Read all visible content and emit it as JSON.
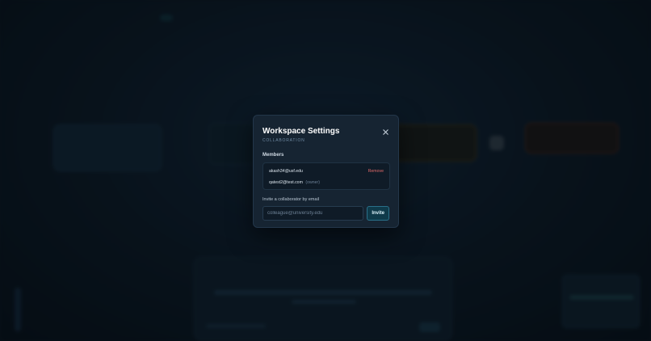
{
  "modal": {
    "title": "Workspace Settings",
    "subtitle": "COLLABORATION",
    "close_icon": "close-icon",
    "members_heading": "Members",
    "members": [
      {
        "email": "akash34@usf.edu",
        "owner_tag": "",
        "action": "Remove"
      },
      {
        "email": "qatest2@test.com",
        "owner_tag": "(owner)",
        "action": ""
      }
    ],
    "invite_label": "Invite a collaborator by email",
    "invite_placeholder": "colleague@university.edu",
    "invite_value": "",
    "invite_button": "Invite"
  },
  "colors": {
    "accent": "#0f3a4a",
    "danger": "#e26a6a",
    "modal_bg": "#162432"
  }
}
